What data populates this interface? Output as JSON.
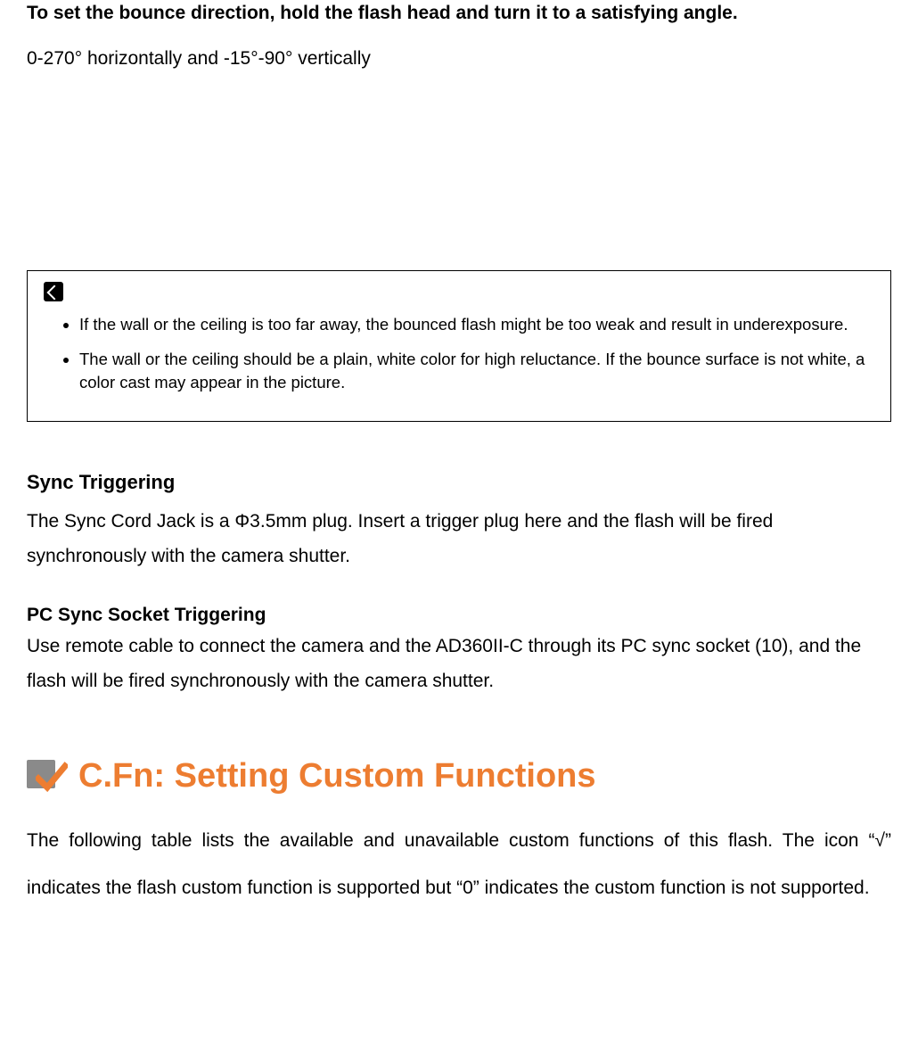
{
  "bounce": {
    "instruction": "To set the bounce direction, hold the flash head and turn it to a satisfying angle.",
    "range": "0-270° horizontally and -15°-90° vertically"
  },
  "notes": {
    "items": [
      "If the wall or the ceiling is too far away, the bounced flash might be too weak and result in underexposure.",
      "The wall or the ceiling should be a plain, white color for high reluctance. If the bounce surface is not white, a color cast may appear in the picture."
    ]
  },
  "sync": {
    "heading": "Sync Triggering",
    "body": "The Sync Cord Jack is a Φ3.5mm plug. Insert a trigger plug here and the flash will be fired synchronously with the camera shutter."
  },
  "pcsync": {
    "heading": "PC Sync Socket Triggering",
    "body": "Use remote cable to connect the camera and the AD360II-C through its PC sync socket (10), and the flash will be fired synchronously with the camera shutter."
  },
  "cfn": {
    "title": "C.Fn: Setting Custom Functions",
    "body": "The following table lists the available and unavailable custom functions of this flash. The icon “√” indicates the flash custom function is supported but  “0” indicates the custom function is not supported."
  }
}
